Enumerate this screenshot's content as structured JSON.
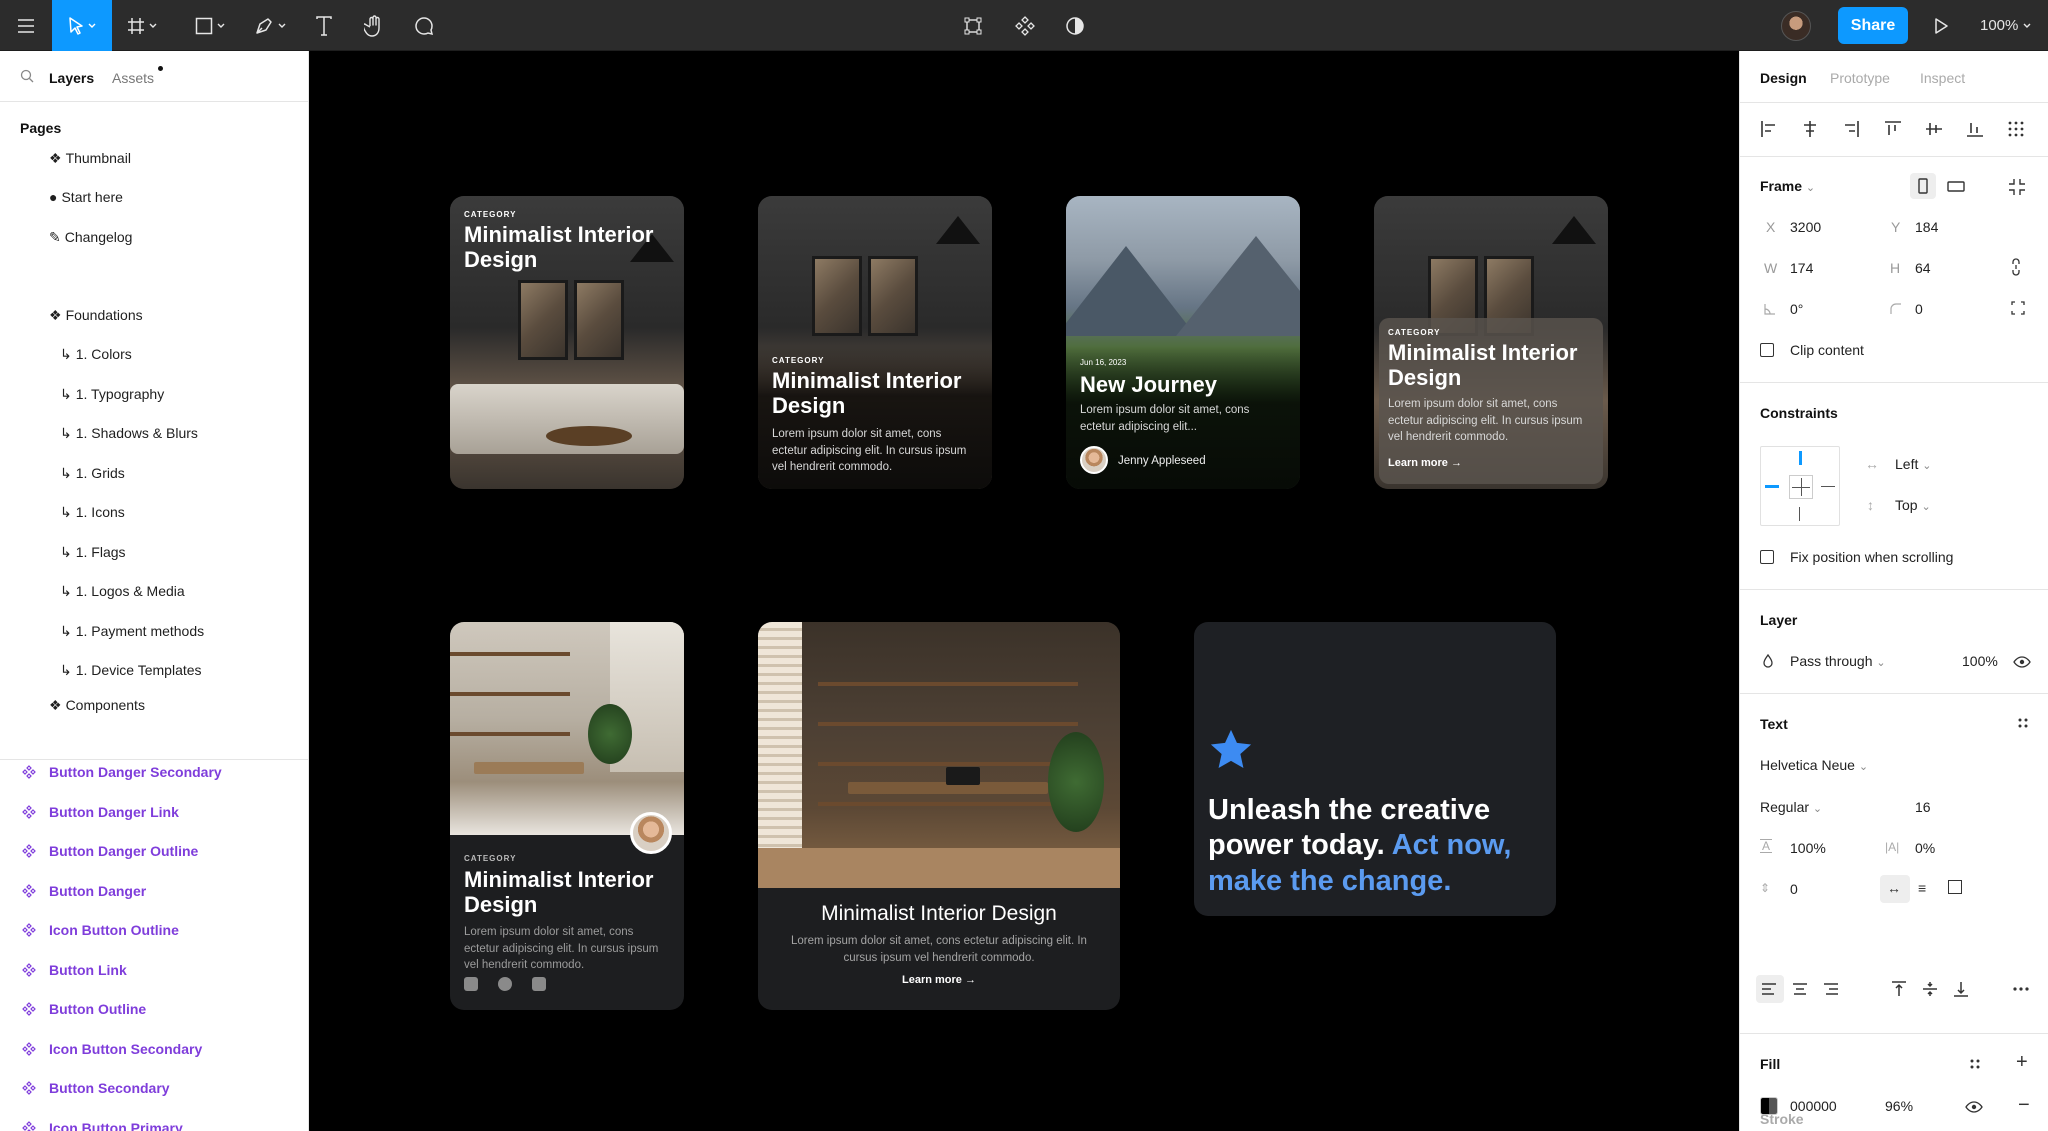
{
  "toolbar": {
    "share_label": "Share",
    "zoom": "100%"
  },
  "left_panel": {
    "tabs": {
      "layers": "Layers",
      "assets": "Assets"
    },
    "pages_title": "Pages",
    "pages": [
      {
        "icon": "❖",
        "label": "Thumbnail"
      },
      {
        "icon": "●",
        "label": "Start here"
      },
      {
        "icon": "✎",
        "label": "Changelog"
      },
      {
        "icon": "❖",
        "label": "Foundations"
      },
      {
        "icon": "↳",
        "label": "1. Colors"
      },
      {
        "icon": "↳",
        "label": "1. Typography"
      },
      {
        "icon": "↳",
        "label": "1. Shadows & Blurs"
      },
      {
        "icon": "↳",
        "label": "1. Grids"
      },
      {
        "icon": "↳",
        "label": "1. Icons"
      },
      {
        "icon": "↳",
        "label": "1. Flags"
      },
      {
        "icon": "↳",
        "label": "1. Logos & Media"
      },
      {
        "icon": "↳",
        "label": "1. Payment methods"
      },
      {
        "icon": "↳",
        "label": "1. Device Templates"
      },
      {
        "icon": "❖",
        "label": "Components"
      }
    ],
    "components": [
      "Button Danger Secondary",
      "Button Danger Link",
      "Button Danger Outline",
      "Button Danger",
      "Icon Button Outline",
      "Button Link",
      "Button Outline",
      "Icon Button Secondary",
      "Button Secondary",
      "Icon Button Primary"
    ]
  },
  "canvas": {
    "card1": {
      "category": "CATEGORY",
      "title": "Minimalist Interior Design"
    },
    "card2": {
      "category": "CATEGORY",
      "title": "Minimalist Interior Design",
      "body": "Lorem ipsum dolor sit amet, cons ectetur adipiscing elit. In cursus ipsum vel hendrerit commodo."
    },
    "card3": {
      "date": "Jun 16, 2023",
      "title": "New Journey",
      "body": "Lorem ipsum dolor sit amet, cons ectetur adipiscing elit...",
      "author": "Jenny Appleseed"
    },
    "card4": {
      "category": "CATEGORY",
      "title": "Minimalist Interior Design",
      "body": "Lorem ipsum dolor sit amet, cons ectetur adipiscing elit. In cursus ipsum vel hendrerit commodo.",
      "link": "Learn more"
    },
    "card5": {
      "category": "CATEGORY",
      "title": "Minimalist Interior Design",
      "body": "Lorem ipsum dolor sit amet, cons ectetur adipiscing elit. In cursus ipsum vel hendrerit commodo."
    },
    "card6": {
      "title": "Minimalist Interior Design",
      "body": "Lorem ipsum dolor sit amet, cons ectetur adipiscing elit. In cursus ipsum vel hendrerit commodo.",
      "link": "Learn more"
    },
    "card7": {
      "headline_white": "Unleash the creative power today. ",
      "headline_blue": "Act now, make the change.",
      "accent": "#5b9bf0",
      "star_color": "#3d8bf2"
    }
  },
  "right_panel": {
    "tabs": {
      "design": "Design",
      "prototype": "Prototype",
      "inspect": "Inspect"
    },
    "frame": {
      "title": "Frame",
      "x_label": "X",
      "x": "3200",
      "y_label": "Y",
      "y": "184",
      "w_label": "W",
      "w": "174",
      "h_label": "H",
      "h": "64",
      "rotation": "0°",
      "radius": "0",
      "clip_content": "Clip content"
    },
    "constraints": {
      "title": "Constraints",
      "horizontal": "Left",
      "vertical": "Top",
      "fix_position": "Fix position when scrolling"
    },
    "layer": {
      "title": "Layer",
      "blend": "Pass through",
      "opacity": "100%"
    },
    "text": {
      "title": "Text",
      "font": "Helvetica Neue",
      "weight": "Regular",
      "size": "16",
      "line_height": "100%",
      "letter_spacing": "0%",
      "paragraph_spacing": "0"
    },
    "fill": {
      "title": "Fill",
      "hex": "000000",
      "opacity": "96%"
    },
    "stroke": {
      "title": "Stroke"
    }
  }
}
